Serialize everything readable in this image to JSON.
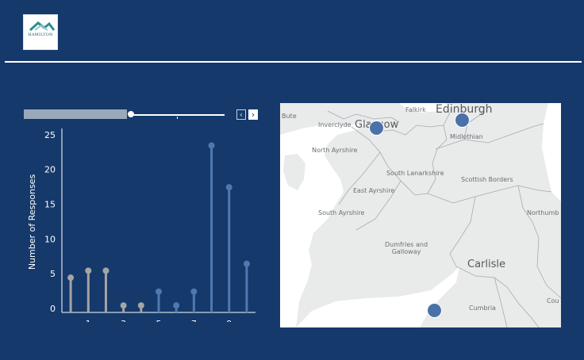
{
  "header": {
    "logo_text": "HAMILTON",
    "logo_color": "#2b8f8f"
  },
  "filter": {
    "prev_icon": "chevron-left-icon",
    "next_icon": "chevron-right-icon",
    "prev_glyph": "‹",
    "next_glyph": "›"
  },
  "chart_data": {
    "type": "bar",
    "ylabel": "Number of Responses",
    "yticks": [
      0,
      5,
      10,
      15,
      20,
      25
    ],
    "ylim": [
      0,
      26
    ],
    "xlim": [
      -0.5,
      10.5
    ],
    "xticks": [
      1,
      3,
      5,
      7,
      9
    ],
    "x": [
      0,
      1,
      2,
      3,
      4,
      5,
      6,
      7,
      8,
      9,
      10
    ],
    "values": [
      5,
      6,
      6,
      1,
      1,
      3,
      1,
      3,
      24,
      18,
      7
    ],
    "colors": [
      "#a5a5a5",
      "#a5a5a5",
      "#a5a5a5",
      "#a5a5a5",
      "#a5a5a5",
      "#4e79b0",
      "#4e79b0",
      "#4e79b0",
      "#4e79b0",
      "#4e79b0",
      "#4e79b0"
    ],
    "grid": false,
    "legend": "none"
  },
  "map": {
    "labels": [
      {
        "text": "Bute",
        "cls": "",
        "key": "bute"
      },
      {
        "text": "Inverclyde",
        "cls": "",
        "key": "inverclyde"
      },
      {
        "text": "Glasgow",
        "cls": "city",
        "key": "glasgow"
      },
      {
        "text": "Falkirk",
        "cls": "",
        "key": "falkirk"
      },
      {
        "text": "Edinburgh",
        "cls": "big",
        "key": "edinburgh"
      },
      {
        "text": "Midlothian",
        "cls": "",
        "key": "midlothian"
      },
      {
        "text": "North Ayrshire",
        "cls": "",
        "key": "north-ayrshire"
      },
      {
        "text": "South Lanarkshire",
        "cls": "",
        "key": "south-lanarkshire"
      },
      {
        "text": "Scottish Borders",
        "cls": "",
        "key": "scottish-borders"
      },
      {
        "text": "East Ayrshire",
        "cls": "",
        "key": "east-ayrshire"
      },
      {
        "text": "South Ayrshire",
        "cls": "",
        "key": "south-ayrshire"
      },
      {
        "text": "Northumb",
        "cls": "",
        "key": "northumberland"
      },
      {
        "text": "Dumfries and\nGalloway",
        "cls": "",
        "key": "dumfries"
      },
      {
        "text": "Carlisle",
        "cls": "city",
        "key": "carlisle"
      },
      {
        "text": "Cumbria",
        "cls": "",
        "key": "cumbria"
      },
      {
        "text": "Cou",
        "cls": "",
        "key": "county"
      }
    ],
    "marker_color": "#4a72a8",
    "land_color": "#e9eaea",
    "water_color": "#ffffff"
  }
}
